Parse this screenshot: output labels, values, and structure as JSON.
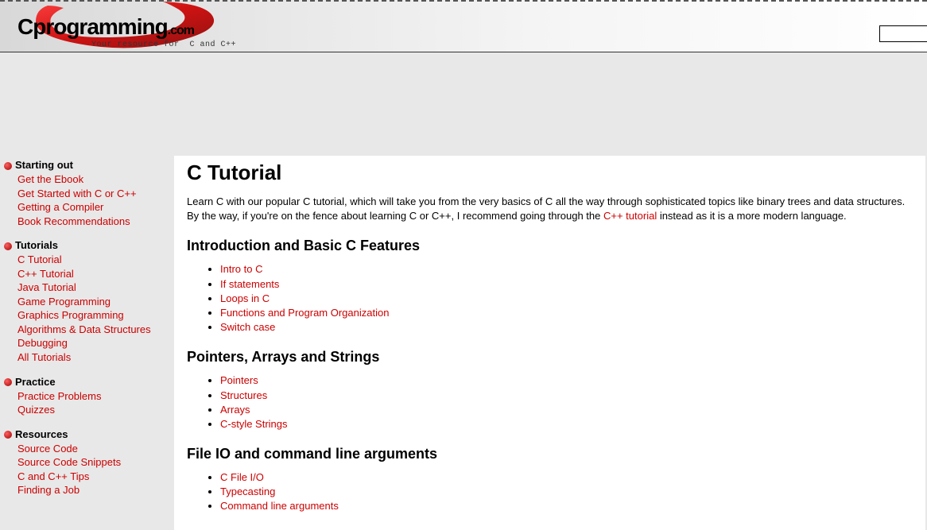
{
  "logo": {
    "main": "Cprogramming",
    "suffix": ".com",
    "tagline": "Your resource for  C and C++"
  },
  "sidebar": {
    "sections": [
      {
        "heading": "Starting out",
        "links": [
          "Get the Ebook",
          "Get Started with C or C++",
          "Getting a Compiler",
          "Book Recommendations"
        ]
      },
      {
        "heading": "Tutorials",
        "links": [
          "C Tutorial",
          "C++ Tutorial",
          "Java Tutorial",
          "Game Programming",
          "Graphics Programming",
          "Algorithms & Data Structures",
          "Debugging",
          "All Tutorials"
        ]
      },
      {
        "heading": "Practice",
        "links": [
          "Practice Problems",
          "Quizzes"
        ]
      },
      {
        "heading": "Resources",
        "links": [
          "Source Code",
          "Source Code Snippets",
          "C and C++ Tips",
          "Finding a Job"
        ]
      }
    ]
  },
  "main": {
    "title": "C Tutorial",
    "intro_before": "Learn C with our popular C tutorial, which will take you from the very basics of C all the way through sophisticated topics like binary trees and data structures. By the way, if you're on the fence about learning C or C++, I recommend going through the ",
    "intro_link": "C++ tutorial",
    "intro_after": " instead as it is a more modern language.",
    "sections": [
      {
        "heading": "Introduction and Basic C Features",
        "links": [
          "Intro to C",
          "If statements",
          "Loops in C",
          "Functions and Program Organization",
          "Switch case"
        ]
      },
      {
        "heading": "Pointers, Arrays and Strings",
        "links": [
          "Pointers",
          "Structures",
          "Arrays",
          "C-style Strings"
        ]
      },
      {
        "heading": "File IO and command line arguments",
        "links": [
          "C File I/O",
          "Typecasting",
          "Command line arguments"
        ]
      }
    ]
  }
}
